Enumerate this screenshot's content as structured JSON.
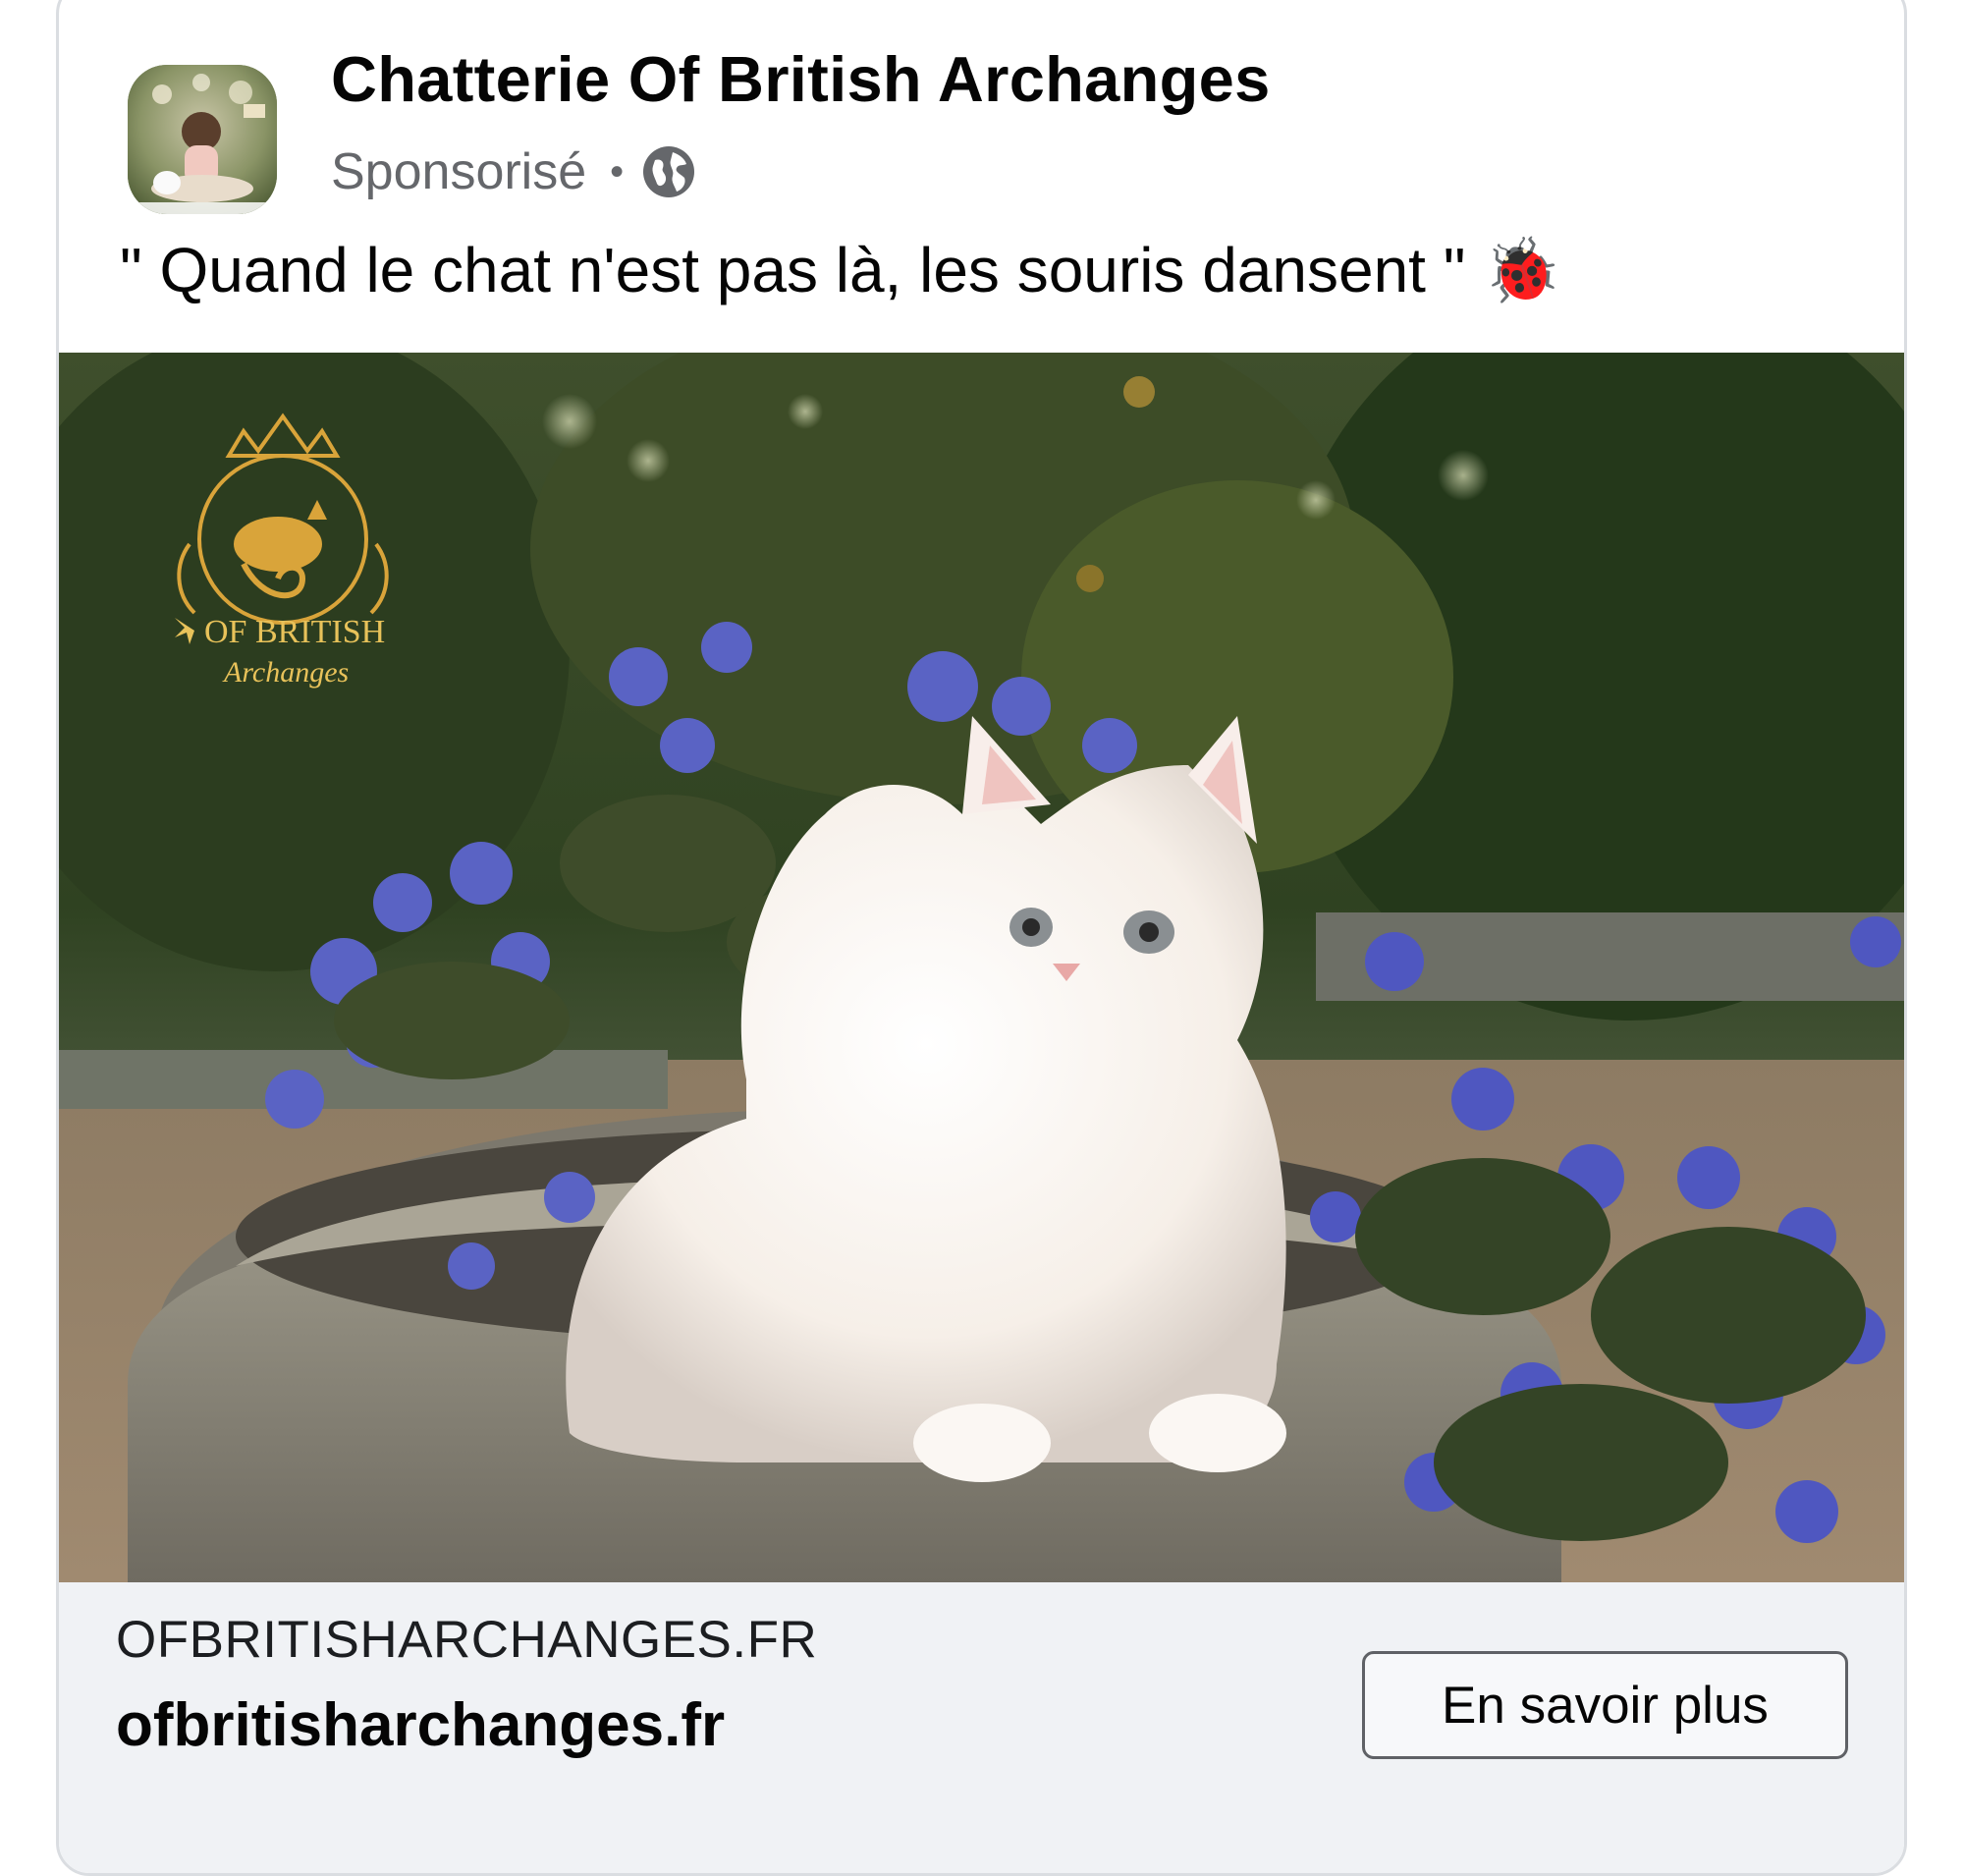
{
  "post": {
    "page_name": "Chatterie Of British Archanges",
    "sponsored_label": "Sponsorisé",
    "separator": "•",
    "audience_icon": "globe-icon",
    "caption": "\" Quand le chat n'est pas là, les souris dansent \" 🐞"
  },
  "media": {
    "watermark_logo_text": "OF BRITISH Archanges"
  },
  "link_preview": {
    "domain_caps": "OFBRITISHARCHANGES.FR",
    "domain": "ofbritisharchanges.fr",
    "cta_label": "En savoir plus"
  },
  "colors": {
    "text_primary": "#050505",
    "text_secondary": "#65676b",
    "link_bar_bg": "#f0f2f5",
    "card_border": "#dadde1",
    "logo_gold": "#d9a43a"
  }
}
